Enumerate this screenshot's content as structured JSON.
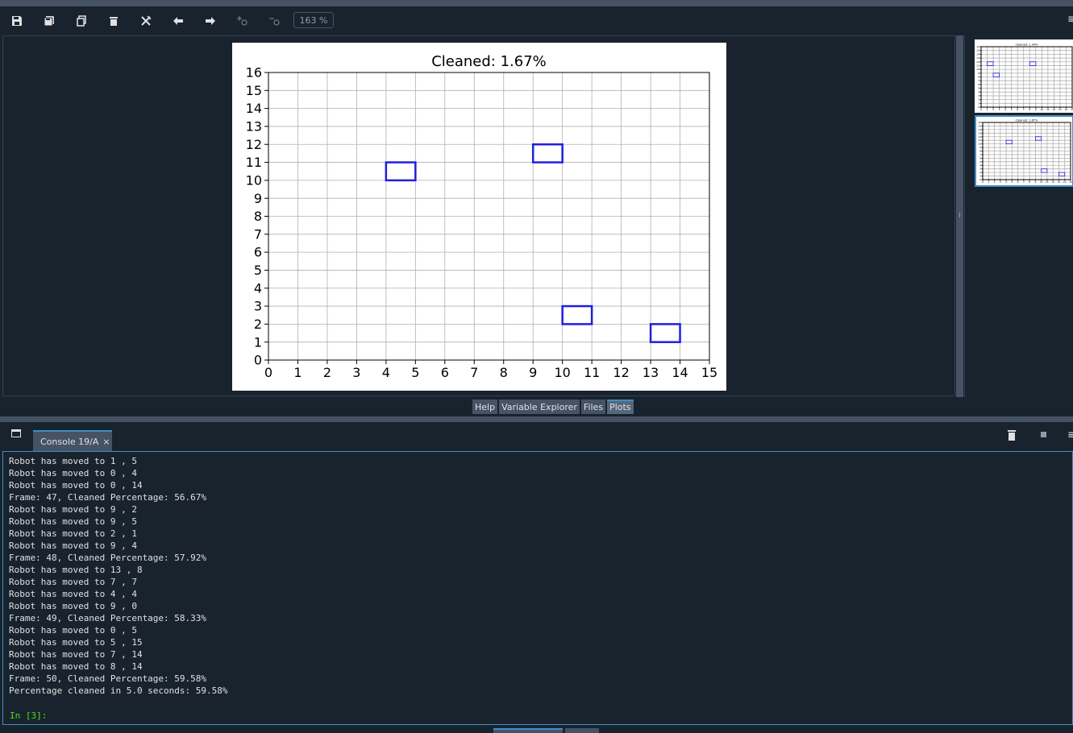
{
  "toolbar": {
    "zoom": "163 %",
    "buttons": [
      "save-icon",
      "save-all-icon",
      "copy-icon",
      "delete-icon",
      "delete-all-icon",
      "previous-icon",
      "next-icon",
      "zoom-in-icon",
      "zoom-out-icon"
    ]
  },
  "tabs": [
    {
      "label": "Help"
    },
    {
      "label": "Variable Explorer"
    },
    {
      "label": "Files"
    },
    {
      "label": "Plots",
      "active": true
    }
  ],
  "console": {
    "tab_label": "Console 19/A",
    "close": "×",
    "lines": [
      "Robot has moved to 1 , 5",
      "Robot has moved to 0 , 4",
      "Robot has moved to 0 , 14",
      "Frame: 47, Cleaned Percentage: 56.67%",
      "Robot has moved to 9 , 2",
      "Robot has moved to 9 , 5",
      "Robot has moved to 2 , 1",
      "Robot has moved to 9 , 4",
      "Frame: 48, Cleaned Percentage: 57.92%",
      "Robot has moved to 13 , 8",
      "Robot has moved to 7 , 7",
      "Robot has moved to 4 , 4",
      "Robot has moved to 9 , 0",
      "Frame: 49, Cleaned Percentage: 58.33%",
      "Robot has moved to 0 , 5",
      "Robot has moved to 5 , 15",
      "Robot has moved to 7 , 14",
      "Robot has moved to 8 , 14",
      "Frame: 50, Cleaned Percentage: 59.58%",
      "Percentage cleaned in 5.0 seconds: 59.58%"
    ],
    "prompt": "In [3]:"
  },
  "chart_data": [
    {
      "type": "scatter",
      "title": "Cleaned: 1.67%",
      "xlim": [
        0,
        15
      ],
      "ylim": [
        0,
        16
      ],
      "xticks": [
        0,
        1,
        2,
        3,
        4,
        5,
        6,
        7,
        8,
        9,
        10,
        11,
        12,
        13,
        14,
        15
      ],
      "yticks": [
        0,
        1,
        2,
        3,
        4,
        5,
        6,
        7,
        8,
        9,
        10,
        11,
        12,
        13,
        14,
        15,
        16
      ],
      "grid": true,
      "marker": "rectangle",
      "color": "#1f1fe0",
      "rects": [
        {
          "x": 4,
          "y": 10,
          "w": 1,
          "h": 1
        },
        {
          "x": 9,
          "y": 11,
          "w": 1,
          "h": 1
        },
        {
          "x": 10,
          "y": 2,
          "w": 1,
          "h": 1
        },
        {
          "x": 13,
          "y": 1,
          "w": 1,
          "h": 1
        }
      ]
    },
    {
      "type": "scatter",
      "title": "Cleaned: 1.34%",
      "thumbnail": true,
      "xlim": [
        0,
        15
      ],
      "ylim": [
        0,
        16
      ],
      "rects": [
        {
          "x": 1,
          "y": 11,
          "w": 1,
          "h": 1
        },
        {
          "x": 2,
          "y": 8,
          "w": 1,
          "h": 1
        },
        {
          "x": 8,
          "y": 11,
          "w": 1,
          "h": 1
        }
      ]
    },
    {
      "type": "scatter",
      "title": "Cleaned: 1.67%",
      "thumbnail": true,
      "xlim": [
        0,
        15
      ],
      "ylim": [
        0,
        16
      ],
      "rects": [
        {
          "x": 4,
          "y": 10,
          "w": 1,
          "h": 1
        },
        {
          "x": 9,
          "y": 11,
          "w": 1,
          "h": 1
        },
        {
          "x": 10,
          "y": 2,
          "w": 1,
          "h": 1
        },
        {
          "x": 13,
          "y": 1,
          "w": 1,
          "h": 1
        }
      ]
    }
  ]
}
